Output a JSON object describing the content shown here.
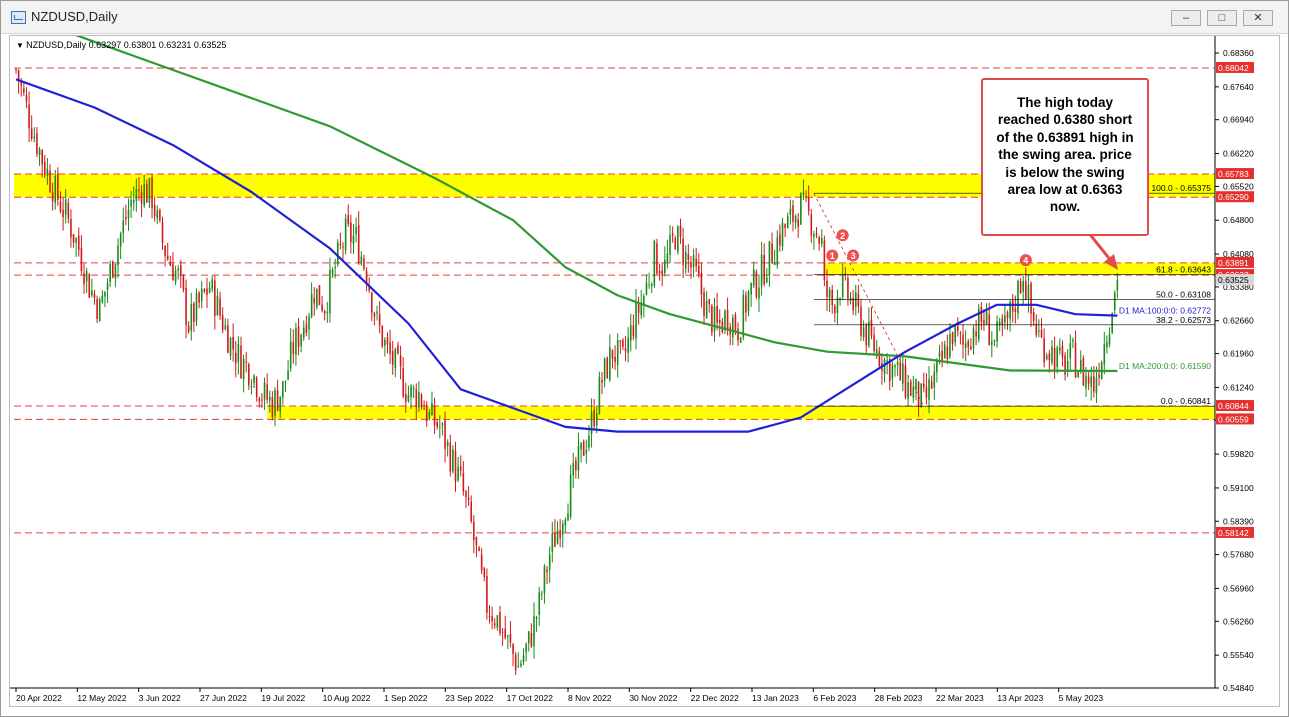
{
  "window": {
    "title": "NZDUSD,Daily",
    "buttons": {
      "minimize": "–",
      "maximize": "□",
      "close": "✕"
    }
  },
  "colors": {
    "bull": "#1a8a1a",
    "bear": "#d11a1a",
    "ma100": "#2020d8",
    "ma200": "#2f9a2f",
    "zone": "#ffff00",
    "level_line": "#e04040",
    "callout_border": "#e24b4b",
    "marker": "#ee5050"
  },
  "chart_data": {
    "type": "candlestick",
    "symbol": "NZDUSD",
    "timeframe": "Daily",
    "ohlc_header": {
      "label": "NZDUSD,Daily",
      "open": "0.63297",
      "high": "0.63801",
      "low": "0.63231",
      "close": "0.63525"
    },
    "ylim": [
      0.5484,
      0.6868
    ],
    "y_ticks": [
      "0.68360",
      "0.67640",
      "0.66940",
      "0.66220",
      "0.65520",
      "0.64800",
      "0.64080",
      "0.63380",
      "0.62660",
      "0.61960",
      "0.61240",
      "0.60540",
      "0.59820",
      "0.59100",
      "0.58390",
      "0.57680",
      "0.56960",
      "0.56260",
      "0.55540",
      "0.54840"
    ],
    "x_ticks": [
      "20 Apr 2022",
      "12 May 2022",
      "3 Jun 2022",
      "27 Jun 2022",
      "19 Jul 2022",
      "10 Aug 2022",
      "1 Sep 2022",
      "23 Sep 2022",
      "17 Oct 2022",
      "8 Nov 2022",
      "30 Nov 2022",
      "22 Dec 2022",
      "13 Jan 2023",
      "6 Feb 2023",
      "28 Feb 2023",
      "22 Mar 2023",
      "13 Apr 2023",
      "5 May 2023"
    ],
    "price_path": [
      [
        0,
        0.68
      ],
      [
        5,
        0.67
      ],
      [
        10,
        0.661
      ],
      [
        15,
        0.654
      ],
      [
        20,
        0.648
      ],
      [
        24,
        0.642
      ],
      [
        28,
        0.634
      ],
      [
        32,
        0.629
      ],
      [
        36,
        0.637
      ],
      [
        40,
        0.645
      ],
      [
        44,
        0.652
      ],
      [
        48,
        0.655
      ],
      [
        52,
        0.653
      ],
      [
        55,
        0.645
      ],
      [
        58,
        0.64
      ],
      [
        62,
        0.636
      ],
      [
        66,
        0.626
      ],
      [
        70,
        0.63
      ],
      [
        74,
        0.634
      ],
      [
        78,
        0.628
      ],
      [
        82,
        0.622
      ],
      [
        86,
        0.618
      ],
      [
        90,
        0.616
      ],
      [
        94,
        0.611
      ],
      [
        98,
        0.609
      ],
      [
        102,
        0.612
      ],
      [
        106,
        0.621
      ],
      [
        110,
        0.626
      ],
      [
        114,
        0.633
      ],
      [
        118,
        0.63
      ],
      [
        122,
        0.638
      ],
      [
        126,
        0.645
      ],
      [
        130,
        0.644
      ],
      [
        134,
        0.637
      ],
      [
        138,
        0.626
      ],
      [
        142,
        0.62
      ],
      [
        146,
        0.616
      ],
      [
        150,
        0.611
      ],
      [
        154,
        0.611
      ],
      [
        158,
        0.606
      ],
      [
        162,
        0.604
      ],
      [
        166,
        0.598
      ],
      [
        170,
        0.592
      ],
      [
        174,
        0.583
      ],
      [
        177,
        0.574
      ],
      [
        180,
        0.566
      ],
      [
        184,
        0.563
      ],
      [
        188,
        0.558
      ],
      [
        192,
        0.553
      ],
      [
        196,
        0.558
      ],
      [
        200,
        0.566
      ],
      [
        204,
        0.577
      ],
      [
        208,
        0.584
      ],
      [
        212,
        0.591
      ],
      [
        216,
        0.598
      ],
      [
        220,
        0.605
      ],
      [
        224,
        0.614
      ],
      [
        228,
        0.62
      ],
      [
        232,
        0.618
      ],
      [
        236,
        0.626
      ],
      [
        240,
        0.632
      ],
      [
        244,
        0.64
      ],
      [
        248,
        0.638
      ],
      [
        252,
        0.645
      ],
      [
        256,
        0.64
      ],
      [
        260,
        0.636
      ],
      [
        264,
        0.629
      ],
      [
        268,
        0.625
      ],
      [
        272,
        0.628
      ],
      [
        276,
        0.625
      ],
      [
        280,
        0.632
      ],
      [
        284,
        0.636
      ],
      [
        288,
        0.64
      ],
      [
        292,
        0.645
      ],
      [
        296,
        0.648
      ],
      [
        300,
        0.651
      ],
      [
        304,
        0.648
      ],
      [
        308,
        0.643
      ],
      [
        309,
        0.633
      ],
      [
        312,
        0.63
      ],
      [
        315,
        0.634
      ],
      [
        318,
        0.632
      ],
      [
        321,
        0.629
      ],
      [
        324,
        0.625
      ],
      [
        328,
        0.621
      ],
      [
        332,
        0.618
      ],
      [
        336,
        0.616
      ],
      [
        340,
        0.613
      ],
      [
        344,
        0.611
      ],
      [
        347,
        0.609
      ],
      [
        350,
        0.613
      ],
      [
        354,
        0.618
      ],
      [
        358,
        0.624
      ],
      [
        362,
        0.621
      ],
      [
        366,
        0.625
      ],
      [
        370,
        0.627
      ],
      [
        374,
        0.622
      ],
      [
        378,
        0.625
      ],
      [
        382,
        0.631
      ],
      [
        385,
        0.637
      ],
      [
        388,
        0.628
      ],
      [
        392,
        0.622
      ],
      [
        396,
        0.62
      ],
      [
        400,
        0.617
      ],
      [
        404,
        0.619
      ],
      [
        408,
        0.615
      ],
      [
        412,
        0.613
      ],
      [
        416,
        0.622
      ],
      [
        419,
        0.63
      ],
      [
        421,
        0.6352
      ]
    ],
    "ma100_path": [
      [
        0,
        0.678
      ],
      [
        30,
        0.672
      ],
      [
        60,
        0.664
      ],
      [
        90,
        0.654
      ],
      [
        120,
        0.642
      ],
      [
        150,
        0.626
      ],
      [
        170,
        0.612
      ],
      [
        190,
        0.608
      ],
      [
        210,
        0.604
      ],
      [
        230,
        0.603
      ],
      [
        260,
        0.603
      ],
      [
        280,
        0.603
      ],
      [
        300,
        0.606
      ],
      [
        320,
        0.613
      ],
      [
        340,
        0.62
      ],
      [
        360,
        0.626
      ],
      [
        375,
        0.63
      ],
      [
        390,
        0.63
      ],
      [
        405,
        0.628
      ],
      [
        421,
        0.6277
      ]
    ],
    "ma200_path": [
      [
        0,
        0.692
      ],
      [
        40,
        0.684
      ],
      [
        80,
        0.676
      ],
      [
        120,
        0.668
      ],
      [
        160,
        0.657
      ],
      [
        190,
        0.648
      ],
      [
        210,
        0.638
      ],
      [
        230,
        0.632
      ],
      [
        250,
        0.628
      ],
      [
        270,
        0.625
      ],
      [
        290,
        0.622
      ],
      [
        310,
        0.62
      ],
      [
        340,
        0.619
      ],
      [
        380,
        0.616
      ],
      [
        421,
        0.6159
      ]
    ],
    "horizontal_levels": [
      "0.60042",
      "0.63891",
      "0.63632",
      "0.65290",
      "0.60844",
      "0.60559",
      "0.58142"
    ],
    "price_scale_labels": [
      {
        "value": 0.68042,
        "text": "0.68042"
      },
      {
        "value": 0.65783,
        "text": "0.65783"
      },
      {
        "value": 0.6529,
        "text": "0.65290"
      },
      {
        "value": 0.63891,
        "text": "0.63891"
      },
      {
        "value": 0.63632,
        "text": "0.63632"
      },
      {
        "value": 0.63525,
        "text": "0.63525"
      },
      {
        "value": 0.60844,
        "text": "0.60844"
      },
      {
        "value": 0.60559,
        "text": "0.60559"
      },
      {
        "value": 0.58142,
        "text": "0.58142"
      }
    ],
    "zones": [
      {
        "low": 0.6529,
        "high": 0.65783
      },
      {
        "low": 0.63632,
        "high": 0.63891
      },
      {
        "low": 0.60559,
        "high": 0.60844
      }
    ],
    "fibonacci": {
      "levels": [
        {
          "value": 0.65375,
          "text": "100.0 - 0.65375"
        },
        {
          "value": 0.63643,
          "text": "61.8 - 0.63643"
        },
        {
          "value": 0.63108,
          "text": "50.0 - 0.63108"
        },
        {
          "value": 0.62573,
          "text": "38.2 - 0.62573"
        },
        {
          "value": 0.60841,
          "text": "0.0 - 0.60841"
        }
      ]
    },
    "ma_labels": [
      {
        "value": 0.62772,
        "text": "D1 MA:100:0:0: 0.62772",
        "series": "ma100"
      },
      {
        "value": 0.6159,
        "text": "D1 MA:200:0:0: 0.61590",
        "series": "ma200"
      }
    ],
    "markers": [
      {
        "label": "1",
        "x": 312,
        "value": 0.6405
      },
      {
        "label": "2",
        "x": 316,
        "value": 0.6448
      },
      {
        "label": "3",
        "x": 320,
        "value": 0.6405
      },
      {
        "label": "4",
        "x": 386,
        "value": 0.6395
      }
    ]
  },
  "callout": {
    "text": "The high today reached 0.6380 short of the 0.63891 high in the swing area. price is below the swing area low at 0.6363 now."
  }
}
